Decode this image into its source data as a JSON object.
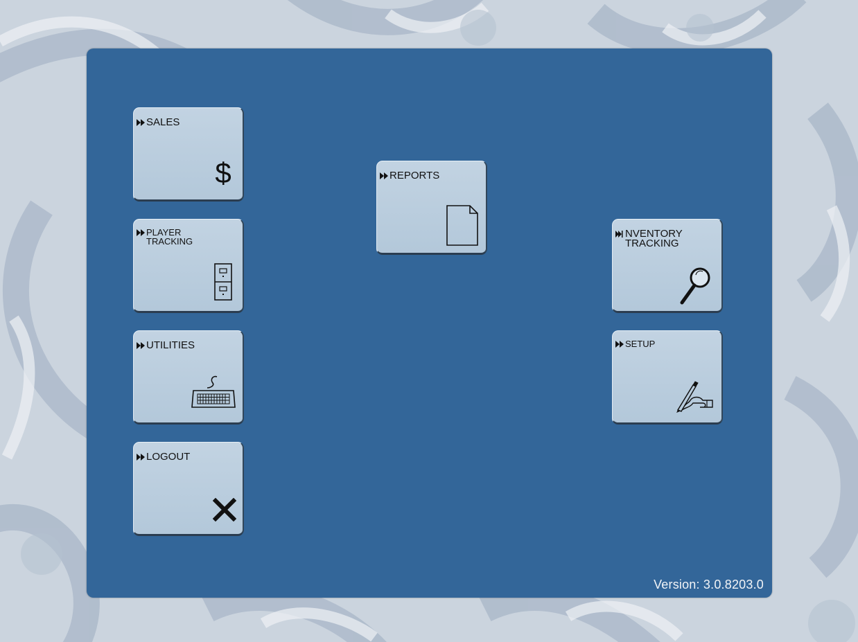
{
  "menu": {
    "sales": {
      "label": "SALES",
      "icon": "dollar-icon"
    },
    "player_tracking": {
      "label": "PLAYER\nTRACKING",
      "icon": "filing-cabinet-icon"
    },
    "utilities": {
      "label": "UTILITIES",
      "icon": "keyboard-icon"
    },
    "logout": {
      "label": "LOGOUT",
      "icon": "close-x-icon"
    },
    "reports": {
      "label": "REPORTS",
      "icon": "document-icon"
    },
    "inventory_tracking": {
      "label": "NVENTORY\nTRACKING",
      "icon": "magnifier-icon"
    },
    "setup": {
      "label": "SETUP",
      "icon": "hand-writing-icon"
    }
  },
  "footer": {
    "version": "Version:  3.0.8203.0"
  },
  "colors": {
    "panel": "#336699",
    "tile": "#b8cbdc",
    "background": "#c9d2dd",
    "version_text": "#f2f4f7"
  }
}
